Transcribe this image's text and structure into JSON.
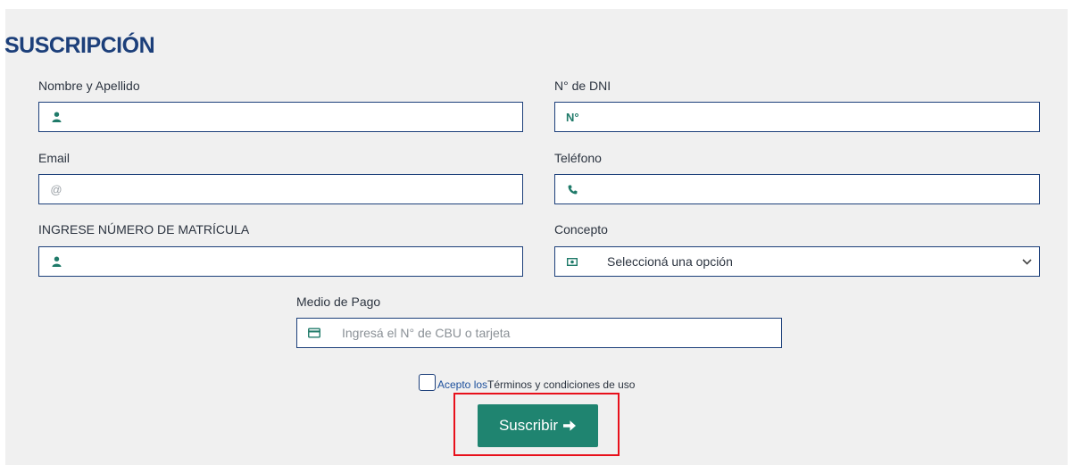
{
  "form": {
    "title": "SUSCRIPCIÓN",
    "fields": {
      "nombre": {
        "label": "Nombre y Apellido",
        "value": "",
        "placeholder": ""
      },
      "dni": {
        "label": "N° de DNI",
        "prefix": "N°",
        "value": "",
        "placeholder": ""
      },
      "email": {
        "label": "Email",
        "prefix": "@",
        "value": "",
        "placeholder": ""
      },
      "telefono": {
        "label": "Teléfono",
        "value": "",
        "placeholder": ""
      },
      "matricula": {
        "label": "INGRESE NÚMERO DE MATRÍCULA",
        "value": "",
        "placeholder": ""
      },
      "concepto": {
        "label": "Concepto",
        "selected": "Seleccioná una opción"
      },
      "medio_pago": {
        "label": "Medio de Pago",
        "value": "",
        "placeholder": "Ingresá el N° de CBU o tarjeta"
      }
    },
    "terms": {
      "prefix": "Acepto los ",
      "link": "Términos y condiciones de uso",
      "checked": false
    },
    "submit_label": "Suscribir",
    "colors": {
      "primary": "#1c3f7a",
      "accent": "#1f8470",
      "highlight": "#e8101b"
    },
    "icons": {
      "nombre": "user-icon",
      "telefono": "phone-icon",
      "matricula": "user-icon",
      "concepto": "money-icon",
      "medio_pago": "credit-card-icon",
      "submit": "arrow-right-icon"
    }
  }
}
